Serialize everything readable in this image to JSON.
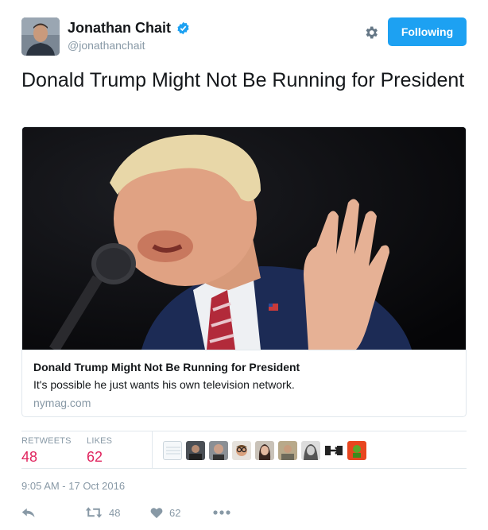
{
  "author": {
    "name": "Jonathan Chait",
    "handle": "@jonathanchait",
    "verified": true
  },
  "follow_button": {
    "label": "Following"
  },
  "tweet": {
    "text": "Donald Trump Might Not Be Running for President",
    "timestamp": "9:05 AM - 17 Oct 2016"
  },
  "card": {
    "title": "Donald Trump Might Not Be Running for President",
    "description": "It's possible he just wants his own television network.",
    "domain": "nymag.com"
  },
  "stats": {
    "retweets_label": "RETWEETS",
    "retweets": "48",
    "likes_label": "LIKES",
    "likes": "62"
  },
  "actions": {
    "retweet_count": "48",
    "like_count": "62"
  },
  "colors": {
    "accent": "#1da1f2",
    "like": "#e0245e",
    "muted": "#8899a6"
  }
}
